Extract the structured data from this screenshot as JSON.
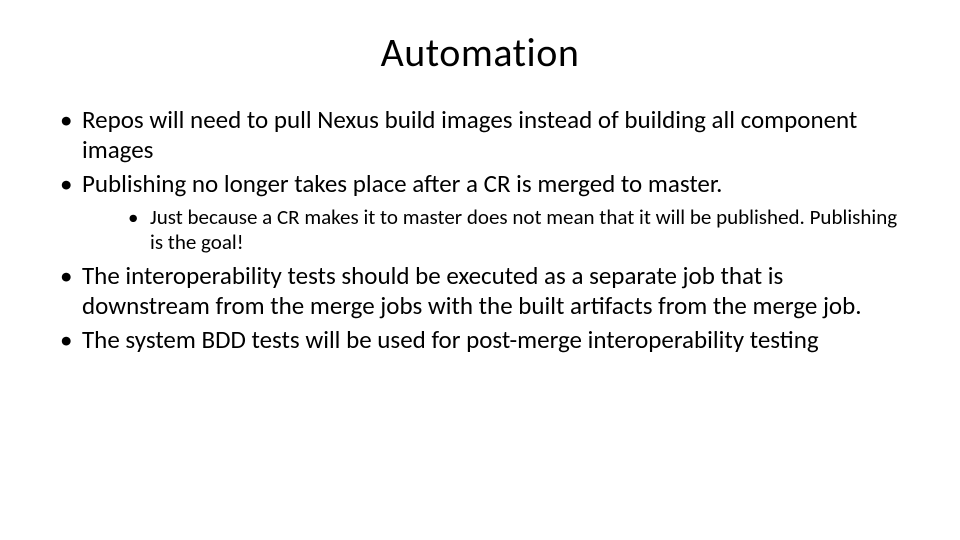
{
  "title": "Automation",
  "bullets": [
    {
      "text": "Repos will need to pull Nexus build images instead of building all component images"
    },
    {
      "text": "Publishing no longer takes place after a CR is merged to master.",
      "sub": [
        {
          "text": "Just because a CR makes it to master does not mean that it will be published. Publishing is the goal!"
        }
      ]
    },
    {
      "text": "The interoperability tests should be executed as a separate job that is downstream from the merge jobs with the built artifacts from the merge job."
    },
    {
      "text": "The system BDD tests will be used for post-merge interoperability testing"
    }
  ]
}
